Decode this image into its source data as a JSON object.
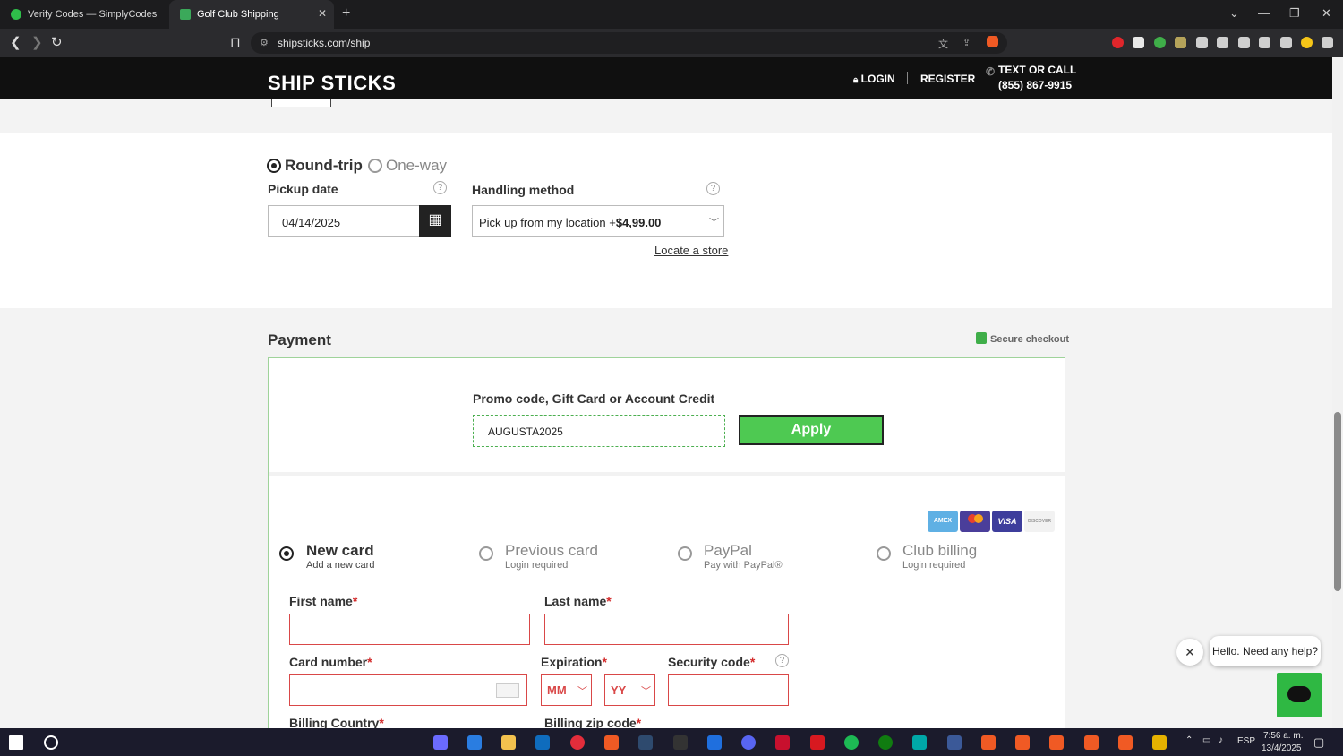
{
  "browser": {
    "tabs": [
      {
        "title": "Verify Codes — SimplyCodes"
      },
      {
        "title": "Golf Club Shipping"
      }
    ],
    "url": "shipsticks.com/ship"
  },
  "header": {
    "logo": "SHIP STICKS",
    "login": "LOGIN",
    "register": "REGISTER",
    "call_label": "TEXT OR CALL",
    "phone": "(855) 867-9915"
  },
  "trip": {
    "roundtrip": "Round-trip",
    "oneway": "One-way"
  },
  "pickup": {
    "label": "Pickup date",
    "value": "04/14/2025"
  },
  "handling": {
    "label": "Handling method",
    "value_text": "Pick up from my location +",
    "value_price": "$4,99.00",
    "locate": "Locate a store"
  },
  "payment": {
    "title": "Payment",
    "secure": "Secure checkout",
    "promo_label": "Promo code, Gift Card or Account Credit",
    "promo_value": "AUGUSTA2025",
    "apply": "Apply",
    "card_logos": [
      "AMEX",
      "MC",
      "VISA",
      "DISCOVER"
    ],
    "options": [
      {
        "title": "New card",
        "sub": "Add a new card"
      },
      {
        "title": "Previous card",
        "sub": "Login required"
      },
      {
        "title": "PayPal",
        "sub": "Pay with PayPal®"
      },
      {
        "title": "Club billing",
        "sub": "Login required"
      }
    ],
    "fields": {
      "first_name": "First name",
      "last_name": "Last name",
      "card_number": "Card number",
      "expiration": "Expiration",
      "mm": "MM",
      "yy": "YY",
      "security_code": "Security code",
      "billing_country": "Billing Country",
      "billing_zip": "Billing zip code",
      "required_mark": "*"
    }
  },
  "chat": {
    "greeting": "Hello. Need any help?"
  },
  "taskbar": {
    "lang": "ESP",
    "time": "7:56 a. m.",
    "date": "13/4/2025"
  },
  "colors": {
    "accent_green": "#4ec952",
    "error_red": "#d94848",
    "header_bg": "#101010"
  }
}
